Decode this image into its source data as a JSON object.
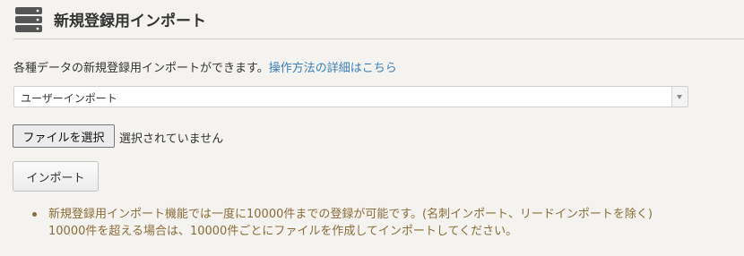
{
  "header": {
    "title": "新規登録用インポート",
    "icon": "database-icon"
  },
  "description": {
    "text": "各種データの新規登録用インポートができます。",
    "link_text": "操作方法の詳細はこちら"
  },
  "import_type_select": {
    "selected": "ユーザーインポート"
  },
  "file_input": {
    "button_label": "ファイルを選択",
    "status": "選択されていません"
  },
  "import_button": {
    "label": "インポート"
  },
  "notes": {
    "line1": "新規登録用インポート機能では一度に10000件までの登録が可能です。(名刺インポート、リードインポートを除く)",
    "line2": "10000件を超える場合は、10000件ごとにファイルを作成してインポートしてください。"
  },
  "colors": {
    "background": "#f4f3ef",
    "link": "#3a7fb6",
    "note_text": "#8a6d3b",
    "icon": "#555555"
  }
}
